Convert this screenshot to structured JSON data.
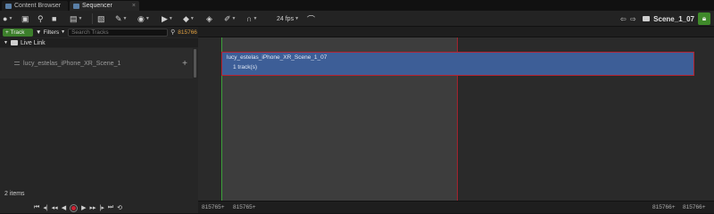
{
  "tabs": [
    {
      "label": "Content Browser"
    },
    {
      "label": "Sequencer",
      "close": "×"
    }
  ],
  "toolbar": {
    "fps": "24 fps",
    "breadcrumb": "Scene_1_07",
    "nav_back": "⇦",
    "nav_fwd": "⇨"
  },
  "left": {
    "add_track": "+ Track",
    "filters": "Filters",
    "search_placeholder": "Search Tracks",
    "current_frame": "815766",
    "folder": "Live Link",
    "track_name": "lucy_estelas_iPhone_XR_Scene_1",
    "item_count": "2 items"
  },
  "section": {
    "name": "lucy_estelas_iPhone_XR_Scene_1_07",
    "tracks": "1 track(s)"
  },
  "frames": {
    "view_start": "815765+",
    "play_start": "815765+",
    "play_end": "815766+",
    "view_end": "815766+"
  },
  "colors": {
    "accent_green": "#3c7f2b",
    "section_blue": "#3d5e97",
    "range_red": "#b72230",
    "frame_orange": "#e0a040"
  }
}
